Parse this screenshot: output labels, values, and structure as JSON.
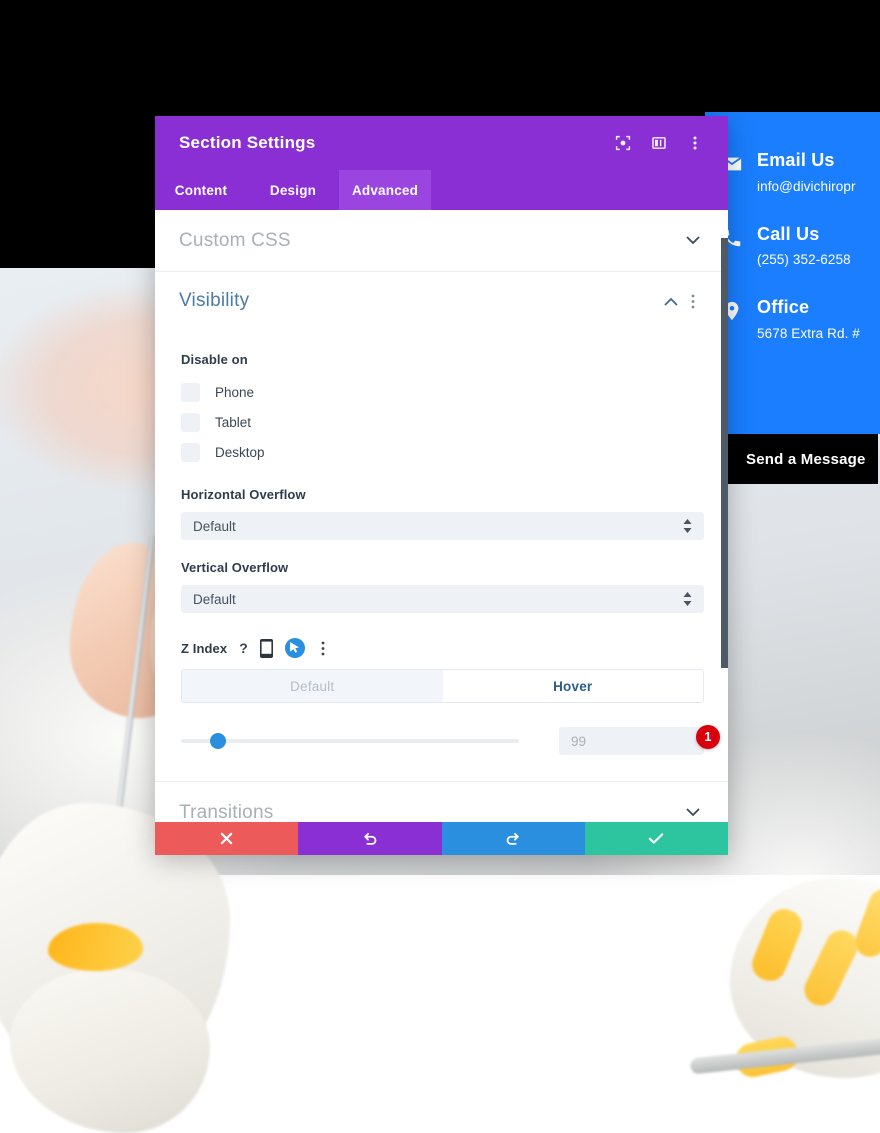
{
  "modal": {
    "title": "Section Settings",
    "header_icons": [
      {
        "name": "focus-target-icon"
      },
      {
        "name": "layout-columns-icon"
      },
      {
        "name": "more-vertical-icon"
      }
    ],
    "tabs": [
      {
        "label": "Content",
        "active": false
      },
      {
        "label": "Design",
        "active": false
      },
      {
        "label": "Advanced",
        "active": true
      }
    ],
    "accordions": [
      {
        "label": "Custom CSS",
        "expanded": false
      },
      {
        "label": "Visibility",
        "expanded": true
      },
      {
        "label": "Transitions",
        "expanded": false
      }
    ],
    "visibility": {
      "disable_on_label": "Disable on",
      "disable_on": [
        {
          "label": "Phone",
          "checked": false
        },
        {
          "label": "Tablet",
          "checked": false
        },
        {
          "label": "Desktop",
          "checked": false
        }
      ],
      "horizontal_overflow": {
        "label": "Horizontal Overflow",
        "value": "Default"
      },
      "vertical_overflow": {
        "label": "Vertical Overflow",
        "value": "Default"
      },
      "z_index": {
        "label": "Z Index",
        "help_icon": "?",
        "icons": [
          "help-icon",
          "mobile-device-icon",
          "hover-cursor-icon",
          "more-vertical-icon"
        ],
        "state_tabs": [
          {
            "label": "Default",
            "active": false
          },
          {
            "label": "Hover",
            "active": true
          }
        ],
        "slider_percent": 11,
        "value": "99",
        "badge": "1"
      }
    },
    "footer_buttons": [
      {
        "name": "cancel-button",
        "icon": "close-x-icon",
        "color": "#ec5a5a"
      },
      {
        "name": "undo-button",
        "icon": "undo-arrow-icon",
        "color": "#8a2fd4"
      },
      {
        "name": "redo-button",
        "icon": "redo-arrow-icon",
        "color": "#2b8fe0"
      },
      {
        "name": "save-button",
        "icon": "checkmark-icon",
        "color": "#2dc4a0"
      }
    ],
    "colors": {
      "header": "#8a2fd4",
      "tab_active": "#9a45e0",
      "accent_blue": "#2b8fe0",
      "badge_red": "#d9000d"
    }
  },
  "website": {
    "contact_panel": {
      "background": "#1a7eff",
      "items": [
        {
          "icon": "envelope-icon",
          "title": "Email Us",
          "sub": "info@divichiropr"
        },
        {
          "icon": "phone-icon",
          "title": "Call Us",
          "sub": "(255) 352-6258"
        },
        {
          "icon": "map-pin-icon",
          "title": "Office",
          "sub": "5678 Extra Rd. #"
        }
      ]
    },
    "send_message_button": "Send a Message"
  }
}
